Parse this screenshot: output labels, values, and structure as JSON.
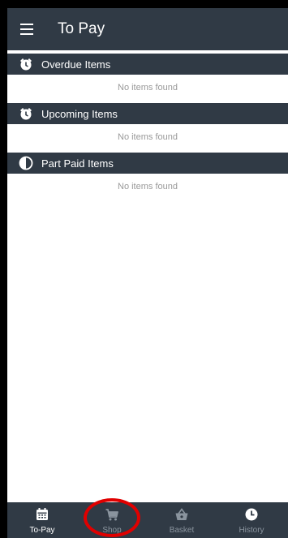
{
  "app": {
    "title": "To Pay"
  },
  "sections": [
    {
      "label": "Overdue Items",
      "icon": "alarm-clock-icon",
      "empty": "No items found"
    },
    {
      "label": "Upcoming Items",
      "icon": "alarm-clock-icon",
      "empty": "No items found"
    },
    {
      "label": "Part Paid Items",
      "icon": "half-circle-icon",
      "empty": "No items found"
    }
  ],
  "bottom_nav": {
    "active": "To-Pay",
    "items": [
      {
        "label": "To-Pay",
        "icon": "calendar-icon"
      },
      {
        "label": "Shop",
        "icon": "cart-icon"
      },
      {
        "label": "Basket",
        "icon": "basket-icon"
      },
      {
        "label": "History",
        "icon": "clock-icon"
      }
    ]
  },
  "colors": {
    "bar": "#303a45",
    "active_nav": "#ffffff",
    "inactive_nav": "#8a949e",
    "empty_text": "#999999",
    "annotation": "#e00000"
  }
}
